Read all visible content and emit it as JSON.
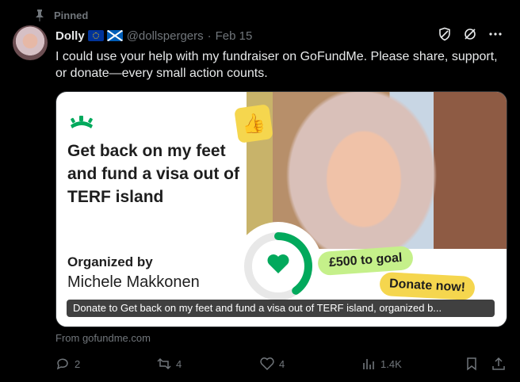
{
  "pinned": {
    "label": "Pinned",
    "icon": "pin-icon"
  },
  "author": {
    "name": "Dolly",
    "flags": [
      "eu-flag",
      "scotland-flag"
    ],
    "handle": "@dollspergers",
    "separator": "·",
    "date": "Feb 15"
  },
  "top_icons": [
    "shield-icon",
    "grok-icon",
    "more-icon"
  ],
  "tweet": {
    "text": "I could use your help with my fundraiser on GoFundMe. Please share, support, or donate—every small action counts."
  },
  "card": {
    "title": "Get back on my feet and fund a visa out of TERF island",
    "organized_by": "Organized by",
    "organizer": "Michele Makkonen",
    "goal": "£500 to goal",
    "donate": "Donate now!",
    "caption": "Donate to Get back on my feet and fund a visa out of TERF island, organized b...",
    "progress_fraction": 0.4,
    "colors": {
      "green": "#02a95c",
      "light_green": "#c5f08a",
      "yellow": "#f5d64e"
    }
  },
  "source": {
    "label": "From gofundme.com"
  },
  "actions": {
    "replies": "2",
    "reposts": "4",
    "likes": "4",
    "views": "1.4K"
  }
}
